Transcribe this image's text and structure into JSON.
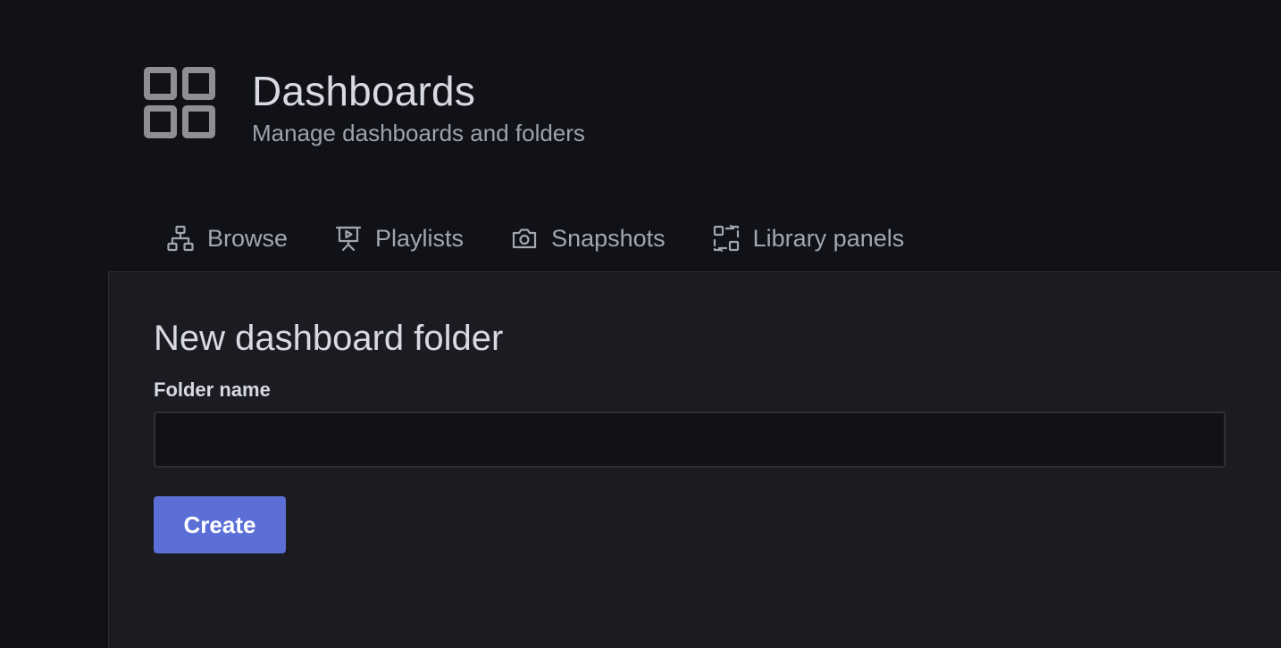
{
  "header": {
    "title": "Dashboards",
    "subtitle": "Manage dashboards and folders",
    "icon": "apps-grid-icon"
  },
  "tabs": [
    {
      "label": "Browse",
      "icon": "sitemap-icon"
    },
    {
      "label": "Playlists",
      "icon": "presentation-play-icon"
    },
    {
      "label": "Snapshots",
      "icon": "camera-icon"
    },
    {
      "label": "Library panels",
      "icon": "library-panel-icon"
    }
  ],
  "form": {
    "title": "New dashboard folder",
    "folder_name_label": "Folder name",
    "folder_name_value": "",
    "create_label": "Create"
  },
  "colors": {
    "background": "#111217",
    "panel": "#1b1c21",
    "primary": "#5b6fd6",
    "text": "#d8d9e3",
    "muted": "#a3a6b2"
  }
}
